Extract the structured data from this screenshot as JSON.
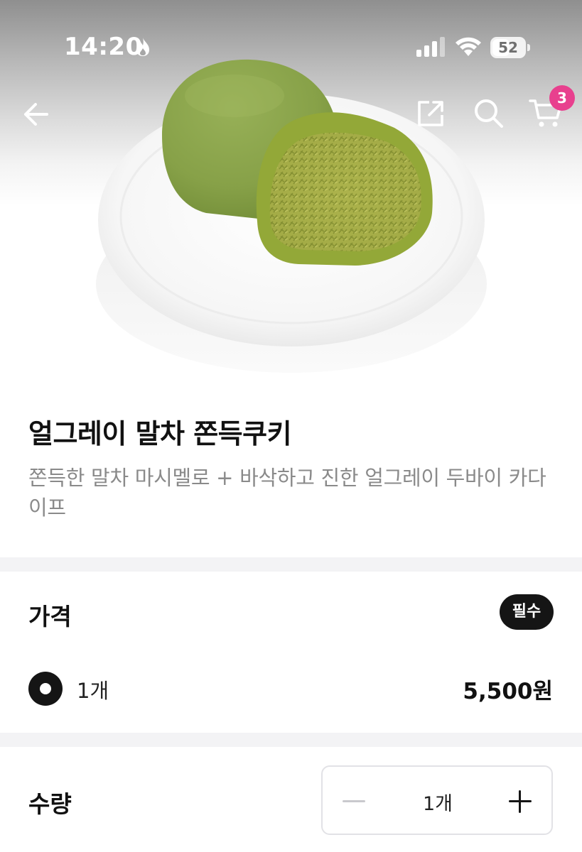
{
  "status_bar": {
    "time": "14:20",
    "battery_level": "52",
    "icons": [
      "flame-icon",
      "signal-icon",
      "wifi-icon",
      "battery-icon"
    ]
  },
  "nav": {
    "icons": [
      "back-arrow-icon",
      "share-icon",
      "search-icon",
      "cart-icon"
    ],
    "cart_badge": "3",
    "badge_color": "#e8408e"
  },
  "product": {
    "title": "얼그레이 말차 쫀득쿠키",
    "description": "쫀득한 말차 마시멜로 + 바삭하고 진한 얼그레이 두바이 카다이프"
  },
  "price_section": {
    "title": "가격",
    "required_badge": "필수",
    "options": [
      {
        "label": "1개",
        "price": "5,500원",
        "selected": true
      }
    ]
  },
  "quantity_section": {
    "title": "수량",
    "value": "1개"
  },
  "colors": {
    "dark": "#151515",
    "muted_text": "#8a8a8a",
    "divider": "#f3f3f5"
  }
}
